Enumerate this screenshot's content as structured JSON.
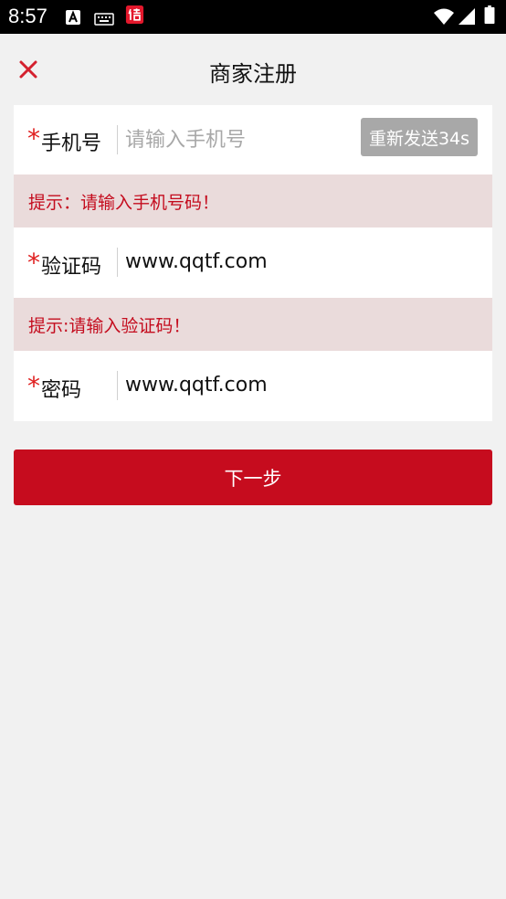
{
  "status_bar": {
    "time": "8:57",
    "icons": [
      "a-notification-icon",
      "keyboard-icon",
      "app-notification-icon",
      "wifi-icon",
      "signal-icon",
      "battery-icon"
    ]
  },
  "header": {
    "title": "商家注册",
    "close_icon": "close-icon"
  },
  "form": {
    "phone": {
      "required_mark": "*",
      "label": "手机号",
      "placeholder": "请输入手机号",
      "value": "",
      "resend_label": "重新发送34s"
    },
    "phone_hint": "提示：请输入手机号码！",
    "code": {
      "required_mark": "*",
      "label": "验证码",
      "value": "www.qqtf.com"
    },
    "code_hint": "提示:请输入验证码！",
    "password": {
      "required_mark": "*",
      "label": "密码",
      "value": "www.qqtf.com"
    }
  },
  "actions": {
    "next_label": "下一步"
  },
  "colors": {
    "accent": "#c60c1e",
    "hint_bg": "#eadbdb",
    "disabled_button": "#a8a8a8",
    "page_bg": "#f1f1f1"
  }
}
